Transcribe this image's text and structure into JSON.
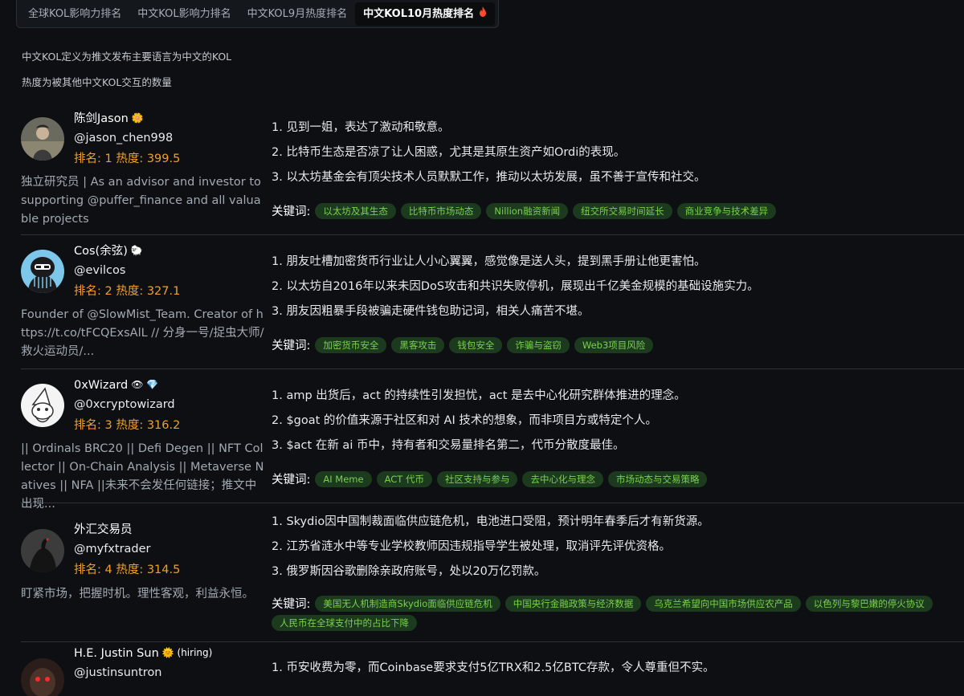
{
  "tabs": [
    {
      "label": "全球KOL影响力排名"
    },
    {
      "label": "中文KOL影响力排名"
    },
    {
      "label": "中文KOL9月热度排名"
    },
    {
      "label": "中文KOL10月热度排名"
    }
  ],
  "description": {
    "line1": "中文KOL定义为推文发布主要语言为中文的KOL",
    "line2": "热度为被其他中文KOL交互的数量"
  },
  "keyword_label": "关键词:",
  "kols": [
    {
      "name": "陈剑Jason",
      "badge": "🌼",
      "handle": "@jason_chen998",
      "rank": "排名: 1 热度: 399.5",
      "bio": "独立研究员 | As an advisor and investor to supporting @puffer_finance and all valuable projects",
      "points": [
        "1. 见到一姐，表达了激动和敬意。",
        "2. 比特币生态是否凉了让人困惑，尤其是其原生资产如Ordi的表现。",
        "3. 以太坊基金会有顶尖技术人员默默工作，推动以太坊发展，虽不善于宣传和社交。"
      ],
      "keywords": [
        "以太坊及其生态",
        "比特币市场动态",
        "Nillion融资新闻",
        "纽交所交易时间延长",
        "商业竞争与技术差异"
      ]
    },
    {
      "name": "Cos(余弦)",
      "badge": "🐑",
      "handle": "@evilcos",
      "rank": "排名: 2 热度: 327.1",
      "bio": "Founder of @SlowMist_Team. Creator of https://t.co/tFCQExsAlL // 分身一号/捉虫大师/救火运动员/...",
      "points": [
        "1. 朋友吐槽加密货币行业让人小心翼翼，感觉像是送人头，提到黑手册让他更害怕。",
        "2. 以太坊自2016年以来未因DoS攻击和共识失败停机，展现出千亿美金规模的基础设施实力。",
        "3. 朋友因粗暴手段被骗走硬件钱包助记词，相关人痛苦不堪。"
      ],
      "keywords": [
        "加密货币安全",
        "黑客攻击",
        "钱包安全",
        "诈骗与盗窃",
        "Web3项目风险"
      ]
    },
    {
      "name": "0xWizard",
      "badge": "👁 💎",
      "handle": "@0xcryptowizard",
      "rank": "排名: 3 热度: 316.2",
      "bio": "|| Ordinals BRC20 || Defi Degen || NFT Collector || On-Chain Analysis || Metaverse Natives || NFA ||未来不会发任何链接；推文中出现...",
      "points": [
        "1. amp 出货后，act 的持续性引发担忧，act 是去中心化研究群体推进的理念。",
        "2. $goat 的价值来源于社区和对 AI 技术的想象，而非项目方或特定个人。",
        "3. $act 在新 ai 币中，持有者和交易量排名第二，代币分散度最佳。"
      ],
      "keywords": [
        "AI Meme",
        "ACT 代币",
        "社区支持与参与",
        "去中心化与理念",
        "市场动态与交易策略"
      ]
    },
    {
      "name": "外汇交易员",
      "badge": "",
      "handle": "@myfxtrader",
      "rank": "排名: 4 热度: 314.5",
      "bio": "盯紧市场，把握时机。理性客观，利益永恒。",
      "points": [
        "1. Skydio因中国制裁面临供应链危机，电池进口受阻，预计明年春季后才有新货源。",
        "2. 江苏省涟水中等专业学校教师因违规指导学生被处理，取消评先评优资格。",
        "3. 俄罗斯因谷歌删除亲政府账号，处以20万亿罚款。"
      ],
      "keywords": [
        "美国无人机制造商Skydio面临供应链危机",
        "中国央行金融政策与经济数据",
        "乌克兰希望向中国市场供应农产品",
        "以色列与黎巴嫩的停火协议",
        "人民币在全球支付中的占比下降"
      ]
    },
    {
      "name": "H.E. Justin Sun",
      "badge": "🌞 (hiring)",
      "handle": "@justinsuntron",
      "rank": "",
      "bio": "",
      "points": [
        "1. 币安收费为零，而Coinbase要求支付5亿TRX和2.5亿BTC存款，令人尊重但不实。"
      ],
      "keywords": []
    }
  ]
}
